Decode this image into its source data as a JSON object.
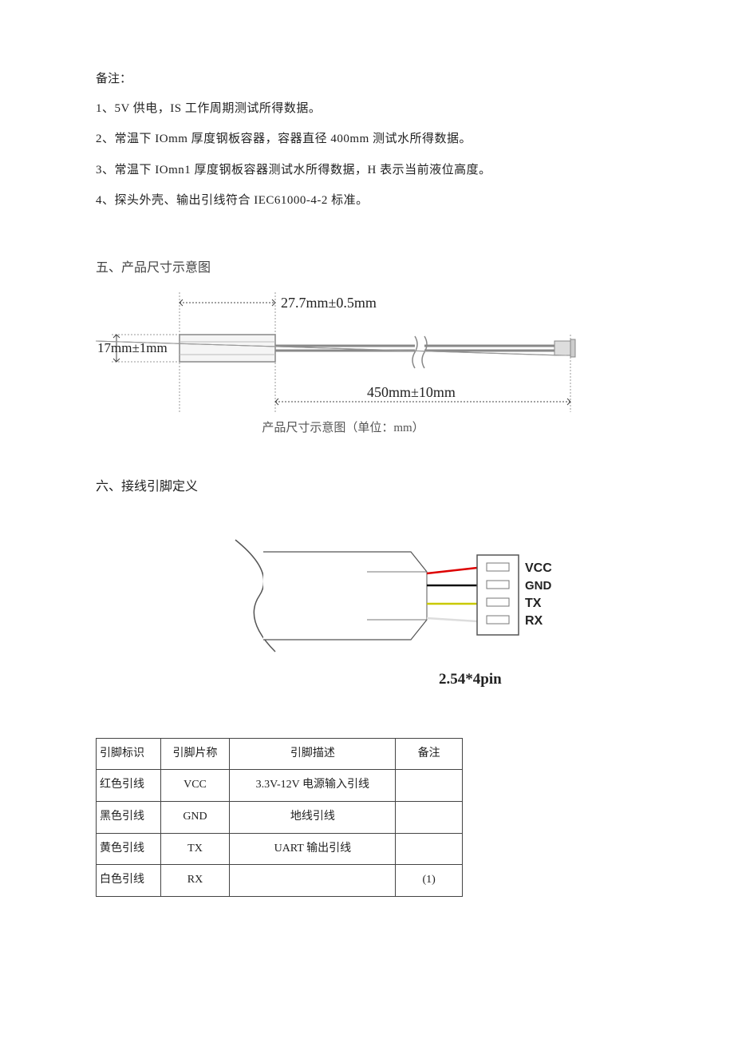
{
  "notes": {
    "title": "备注：",
    "items": [
      "1、5V 供电，IS 工作周期测试所得数据。",
      "2、常温下 IOmm 厚度钢板容器，容器直径 400mm 测试水所得数据。",
      "3、常温下 IOmn1 厚度钢板容器测试水所得数据，H 表示当前液位高度。",
      "4、探头外壳、输出引线符合 IEC61000-4-2 标准。"
    ]
  },
  "section5": {
    "title": "五、产品尺寸示意图",
    "dim_top": "27.7mm±0.5mm",
    "dim_left": "17mm±1mm",
    "dim_bottom": "450mm±10mm",
    "caption": "产品尺寸示意图（单位：mm）"
  },
  "section6": {
    "title": "六、接线引脚定义",
    "pins": [
      "VCC",
      "GND",
      "TX",
      "RX"
    ],
    "connector": "2.54*4pin",
    "table": {
      "headers": [
        "引脚标识",
        "引脚片称",
        "引脚描述",
        "备注"
      ],
      "rows": [
        [
          "红色引线",
          "VCC",
          "3.3V-12V 电源输入引线",
          ""
        ],
        [
          "黑色引线",
          "GND",
          "地线引线",
          ""
        ],
        [
          "黄色引线",
          "TX",
          "UART 输出引线",
          ""
        ],
        [
          "白色引线",
          "RX",
          "",
          "(1)"
        ]
      ]
    }
  }
}
